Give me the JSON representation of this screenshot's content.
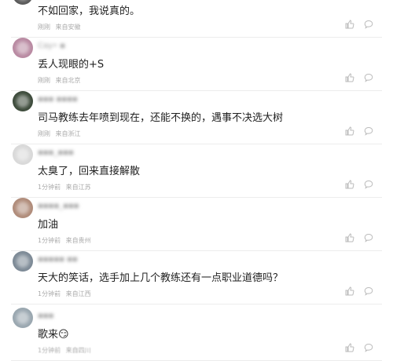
{
  "comments": [
    {
      "username": "████",
      "text": "不如回家，我说真的。",
      "time": "刚刚",
      "location": "来自安徽",
      "avatar_color": "#5a5a5a"
    },
    {
      "username": "Cay• ▪",
      "text": "丢人现眼的+S",
      "time": "刚刚",
      "location": "来自北京",
      "avatar_color": "#b98aa2"
    },
    {
      "username": "▪▪▪ ▪▪▪▪",
      "text": "司马教练去年喷到现在，还能不换的，遇事不决选大树",
      "time": "刚刚",
      "location": "来自浙江",
      "avatar_color": "#3d4b3b"
    },
    {
      "username": "▪▪▪_▪▪▪",
      "text": "太臭了，回来直接解散",
      "time": "1分钟前",
      "location": "来自江苏",
      "avatar_color": "#d9d9d9"
    },
    {
      "username": "▪▪▪▪_▪▪▪",
      "text": "加油",
      "time": "1分钟前",
      "location": "来自贵州",
      "avatar_color": "#b08c7a"
    },
    {
      "username": "▪▪▪▪▪ ▪▪",
      "text": "天大的笑话，选手加上几个教练还有一点职业道德吗？",
      "time": "1分钟前",
      "location": "来自江西",
      "avatar_color": "#7d8a96"
    },
    {
      "username": "▪▪▪",
      "text": "歌来😏",
      "time": "1分钟前",
      "location": "来自四川",
      "avatar_color": "#9aa7b0"
    }
  ],
  "icons": {
    "like": "thumbs-up-icon",
    "reply": "comment-bubble-icon"
  }
}
